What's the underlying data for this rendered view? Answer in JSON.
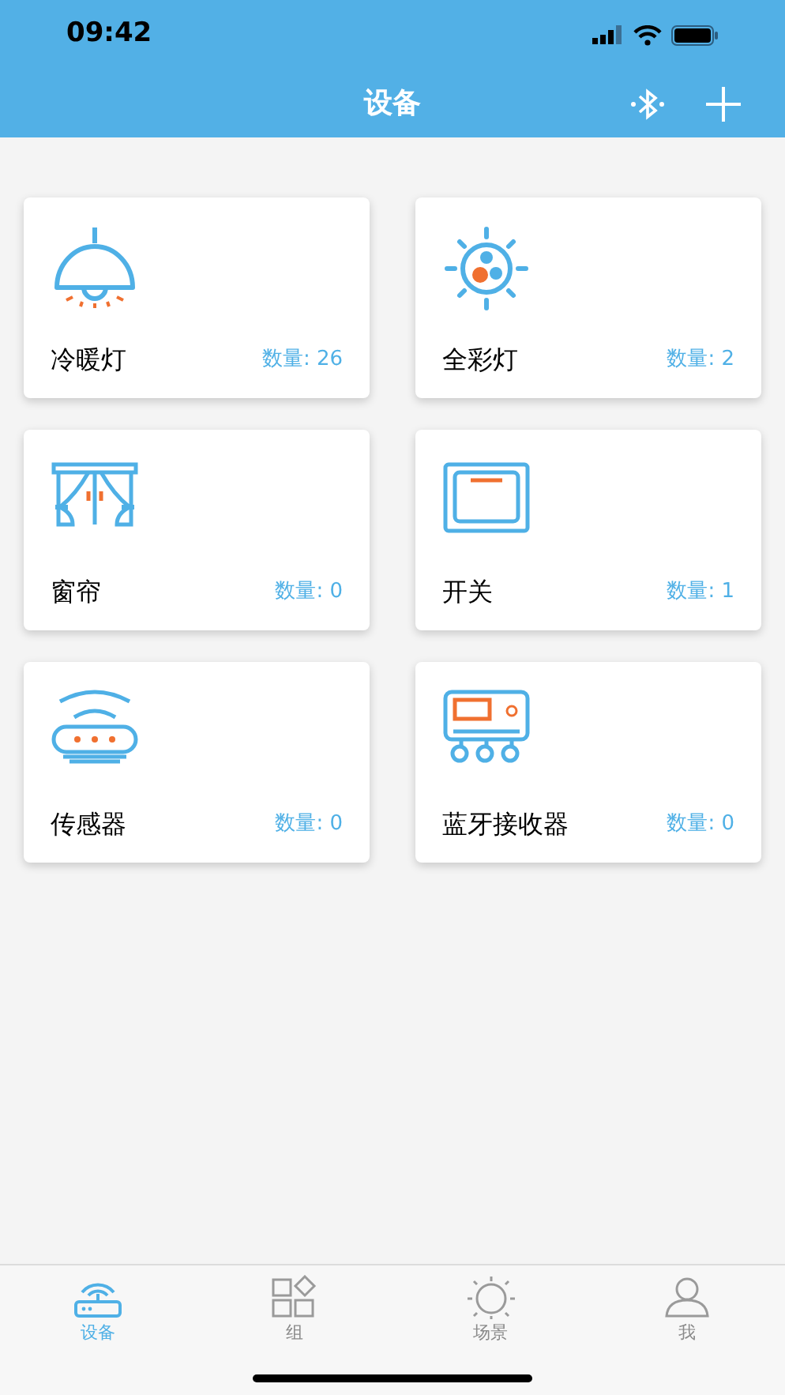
{
  "status_bar": {
    "time": "09:42"
  },
  "nav_bar": {
    "title": "设备"
  },
  "devices": [
    {
      "kind": "lamp",
      "name": "冷暖灯",
      "count": "数量: 26"
    },
    {
      "kind": "color_light",
      "name": "全彩灯",
      "count": "数量: 2"
    },
    {
      "kind": "curtain",
      "name": "窗帘",
      "count": "数量: 0"
    },
    {
      "kind": "switch",
      "name": "开关",
      "count": "数量: 1"
    },
    {
      "kind": "sensor",
      "name": "传感器",
      "count": "数量: 0"
    },
    {
      "kind": "receiver",
      "name": "蓝牙接收器",
      "count": "数量: 0"
    }
  ],
  "tab_bar": [
    {
      "kind": "device",
      "label": "设备",
      "selected": true
    },
    {
      "kind": "group",
      "label": "组",
      "selected": false
    },
    {
      "kind": "scene",
      "label": "场景",
      "selected": false
    },
    {
      "kind": "me",
      "label": "我",
      "selected": false
    }
  ]
}
